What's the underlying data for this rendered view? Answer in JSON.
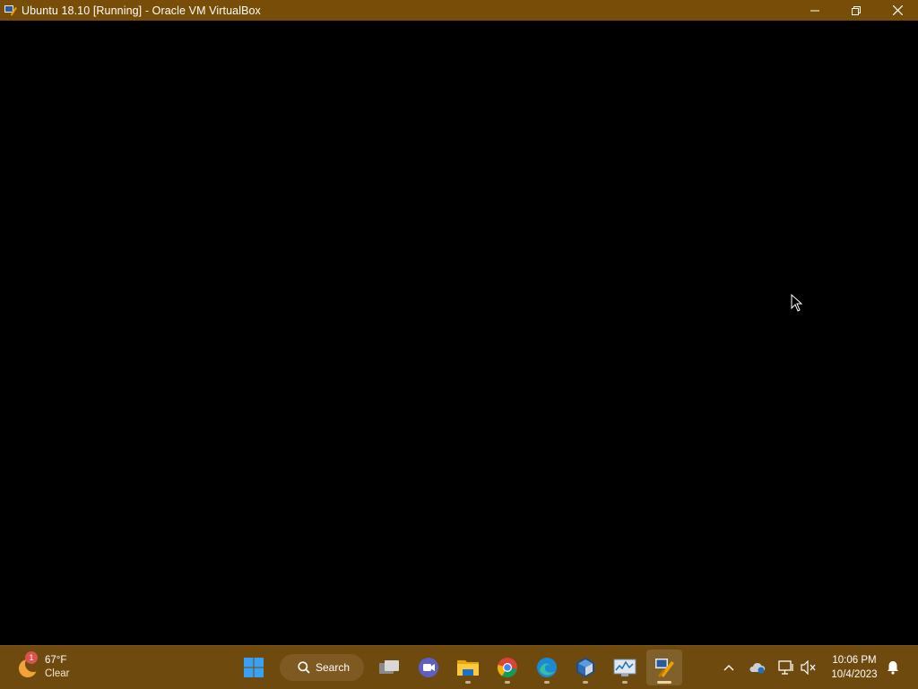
{
  "window": {
    "title": "Ubuntu 18.10 [Running] - Oracle VM VirtualBox",
    "icon": "virtualbox-vm-icon",
    "controls": [
      "minimize-icon",
      "restore-icon",
      "close-icon"
    ]
  },
  "colors": {
    "titlebar": "#784d07",
    "taskbar": "#6f4a0e",
    "vm_screen": "#000000"
  },
  "taskbar": {
    "weather": {
      "badge": "1",
      "temp": "67°F",
      "condition": "Clear"
    },
    "search_label": "Search",
    "apps": [
      {
        "name": "start-button",
        "icon": "windows-logo-icon"
      },
      {
        "name": "task-view",
        "icon": "task-view-icon"
      },
      {
        "name": "teams-meet",
        "icon": "video-chat-icon"
      },
      {
        "name": "file-explorer",
        "icon": "folder-icon"
      },
      {
        "name": "chrome",
        "icon": "chrome-icon"
      },
      {
        "name": "edge",
        "icon": "edge-icon"
      },
      {
        "name": "virtualbox-manager",
        "icon": "virtualbox-icon"
      },
      {
        "name": "resource-monitor",
        "icon": "monitor-chart-icon"
      },
      {
        "name": "ubuntu-vm-window",
        "icon": "virtualbox-vm-icon"
      }
    ],
    "tray": [
      "chevron-up-icon",
      "onedrive-icon",
      "network-icon",
      "volume-muted-icon"
    ],
    "clock": {
      "time": "10:06 PM",
      "date": "10/4/2023"
    },
    "notification_icon": "bell-icon"
  }
}
